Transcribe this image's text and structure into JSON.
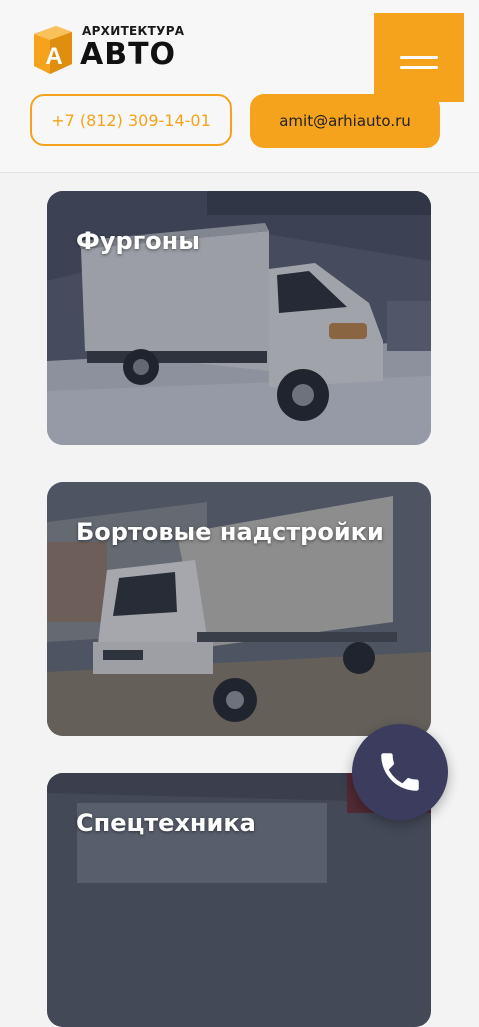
{
  "header": {
    "logo": {
      "top_text": "АРХИТЕКТУРА",
      "main_text": "АВТО",
      "mark_letter": "А"
    },
    "menu_icon": "hamburger-menu-icon",
    "phone": "+7 (812) 309-14-01",
    "email": "amit@arhiauto.ru"
  },
  "colors": {
    "accent": "#f5a31d",
    "fab": "#3b3c5e",
    "text_dark": "#222222"
  },
  "categories": [
    {
      "title": "Фургоны"
    },
    {
      "title": "Бортовые надстройки"
    },
    {
      "title": "Спецтехника"
    }
  ],
  "call_button": {
    "icon": "phone-icon"
  }
}
